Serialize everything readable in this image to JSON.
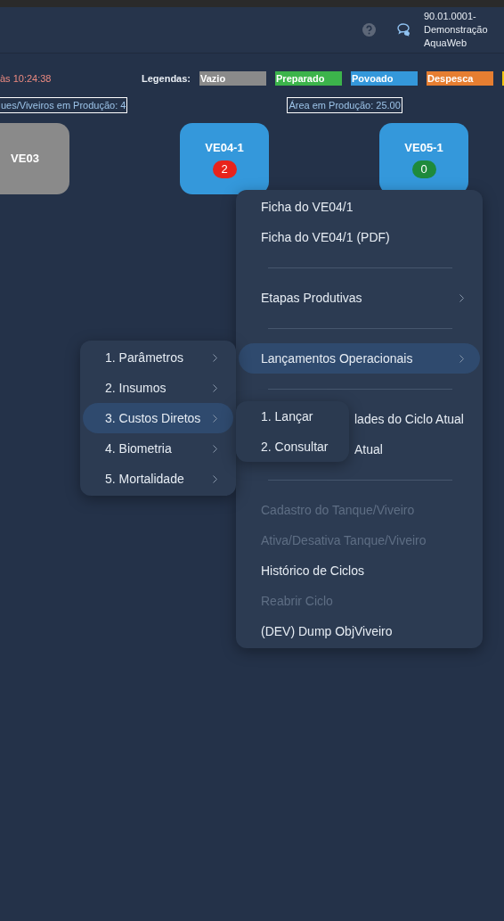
{
  "header": {
    "account_lines": [
      "90.01.0001-",
      "Demonstração",
      "AquaWeb"
    ]
  },
  "status": {
    "timestamp": "às 10:24:38"
  },
  "legend": {
    "label": "Legendas:",
    "items": [
      {
        "label": "Vazio",
        "color": "#8a8a8a"
      },
      {
        "label": "Preparado",
        "color": "#3cb44b"
      },
      {
        "label": "Povoado",
        "color": "#3498db"
      },
      {
        "label": "Despesca",
        "color": "#e67e31"
      },
      {
        "color": "#f1c40f"
      }
    ]
  },
  "summary": [
    "ues/Viveiros em Produção: 4",
    "Área em Produção: 25.00"
  ],
  "tanks": [
    {
      "name": "VE03",
      "color": "#8a8a8a"
    },
    {
      "name": "VE04-1",
      "color": "#3498db",
      "badge": {
        "label": "2",
        "color": "#e8231c"
      }
    },
    {
      "name": "VE05-1",
      "color": "#3498db",
      "badge": {
        "label": "0",
        "color": "#1e8a3c"
      }
    }
  ],
  "context_menu": {
    "items": [
      {
        "kind": "item",
        "label": "Ficha do VE04/1",
        "disabled": false,
        "selected": false,
        "has_submenu": false
      },
      {
        "kind": "item",
        "label": "Ficha do VE04/1 (PDF)",
        "disabled": false,
        "selected": false,
        "has_submenu": false
      },
      {
        "kind": "divider"
      },
      {
        "kind": "item",
        "label": "Etapas Produtivas",
        "disabled": false,
        "selected": false,
        "has_submenu": true
      },
      {
        "kind": "divider"
      },
      {
        "kind": "item",
        "label": "Lançamentos Operacionais",
        "disabled": false,
        "selected": true,
        "has_submenu": true
      },
      {
        "kind": "divider"
      },
      {
        "kind": "covered",
        "label": "lades do Ciclo Atual",
        "disabled": false,
        "selected": false,
        "has_submenu": false
      },
      {
        "kind": "covered",
        "label": "Atual",
        "disabled": false,
        "selected": false,
        "has_submenu": false
      },
      {
        "kind": "divider"
      },
      {
        "kind": "item",
        "label": "Cadastro do Tanque/Viveiro",
        "disabled": true,
        "selected": false,
        "has_submenu": false
      },
      {
        "kind": "item",
        "label": "Ativa/Desativa Tanque/Viveiro",
        "disabled": true,
        "selected": false,
        "has_submenu": false
      },
      {
        "kind": "item",
        "label": "Histórico de Ciclos",
        "disabled": false,
        "selected": false,
        "has_submenu": false
      },
      {
        "kind": "item",
        "label": "Reabrir Ciclo",
        "disabled": true,
        "selected": false,
        "has_submenu": false
      },
      {
        "kind": "item",
        "label": "(DEV) Dump ObjViveiro",
        "disabled": false,
        "selected": false,
        "has_submenu": false
      }
    ]
  },
  "submenu": {
    "items": [
      {
        "kind": "item",
        "label": "1. Parâmetros",
        "disabled": false,
        "selected": false,
        "has_submenu": true
      },
      {
        "kind": "item",
        "label": "2. Insumos",
        "disabled": false,
        "selected": false,
        "has_submenu": true
      },
      {
        "kind": "item",
        "label": "3. Custos Diretos",
        "disabled": false,
        "selected": true,
        "has_submenu": true
      },
      {
        "kind": "item",
        "label": "4. Biometria",
        "disabled": false,
        "selected": false,
        "has_submenu": true
      },
      {
        "kind": "item",
        "label": "5. Mortalidade",
        "disabled": false,
        "selected": false,
        "has_submenu": true
      }
    ]
  },
  "submenu_2": {
    "items": [
      {
        "kind": "item",
        "label": "1. Lançar",
        "disabled": false,
        "selected": false,
        "has_submenu": false
      },
      {
        "kind": "item",
        "label": "2. Consultar",
        "disabled": false,
        "selected": false,
        "has_submenu": false
      }
    ]
  }
}
